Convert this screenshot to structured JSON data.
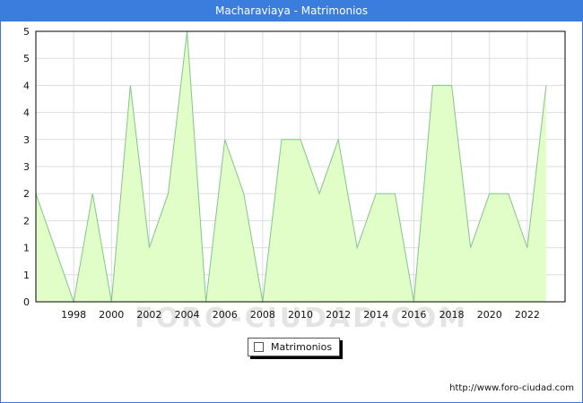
{
  "title": "Macharaviaya - Matrimonios",
  "watermark": "FORO-CIUDAD.COM",
  "source": "http://www.foro-ciudad.com",
  "colors": {
    "fill": "#e2fec8",
    "line": "#82c48c",
    "title_bg": "#3b7ddd",
    "grid": "#dddddd"
  },
  "chart_data": {
    "type": "area",
    "x": [
      1996,
      1997,
      1998,
      1999,
      2000,
      2001,
      2002,
      2003,
      2004,
      2005,
      2006,
      2007,
      2008,
      2009,
      2010,
      2011,
      2012,
      2013,
      2014,
      2015,
      2016,
      2017,
      2018,
      2019,
      2020,
      2021,
      2022,
      2023
    ],
    "series": [
      {
        "name": "Matrimonios",
        "values": [
          4,
          2,
          0,
          4,
          0,
          8,
          2,
          4,
          10,
          0,
          6,
          4,
          0,
          6,
          6,
          4,
          6,
          2,
          4,
          4,
          0,
          8,
          8,
          2,
          4,
          4,
          2,
          8
        ]
      }
    ],
    "y_tick_values": [
      0,
      1,
      2,
      3,
      4,
      5,
      6,
      7,
      8,
      9,
      10
    ],
    "y_tick_labels": [
      "0",
      "1",
      "1",
      "2",
      "2",
      "3",
      "3",
      "4",
      "4",
      "5",
      "5"
    ],
    "x_tick_labels": [
      "1998",
      "2000",
      "2002",
      "2004",
      "2006",
      "2008",
      "2010",
      "2012",
      "2014",
      "2016",
      "2018",
      "2020",
      "2022"
    ],
    "xlim": [
      1996,
      2024
    ],
    "ylim": [
      0,
      10
    ],
    "grid": true,
    "legend": "bottom-center"
  }
}
